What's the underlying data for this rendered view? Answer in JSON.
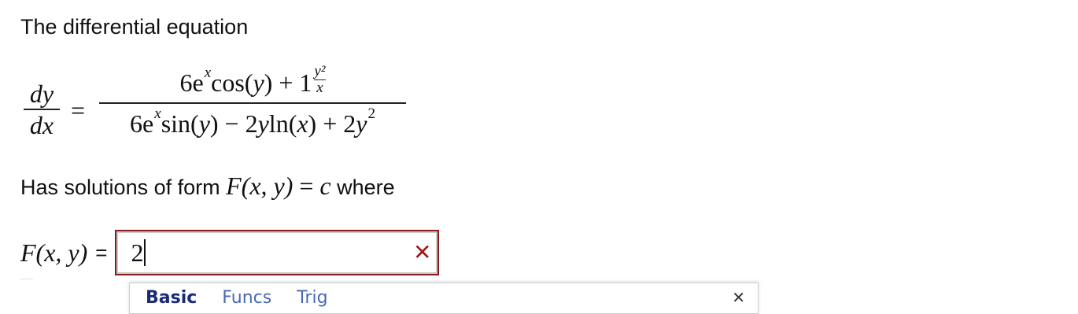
{
  "intro": {
    "text": "The differential equation"
  },
  "equation": {
    "lhs_num": "dy",
    "lhs_den": "dx",
    "equals": "=",
    "rhs_num_a": "6e",
    "rhs_num_a_sup": "x",
    "rhs_num_b": " cos(",
    "rhs_num_b_var": "y",
    "rhs_num_c": ") + 1",
    "rhs_num_frac_num": "y²",
    "rhs_num_frac_den": "x",
    "rhs_den_a": "6e",
    "rhs_den_a_sup": "x",
    "rhs_den_b": " sin(",
    "rhs_den_b_var": "y",
    "rhs_den_c": ") − 2",
    "rhs_den_c_var": "y",
    "rhs_den_d": " ln(",
    "rhs_den_d_var": "x",
    "rhs_den_e": ") + 2",
    "rhs_den_e_var": "y",
    "rhs_den_e_sup": "2"
  },
  "solution_line": {
    "prefix": "Has solutions of form ",
    "math_F": "F",
    "math_args": "(x, y)",
    "math_eq": " = ",
    "math_c": "c",
    "suffix": " where"
  },
  "answer": {
    "label_F": "F",
    "label_args": "(x, y)",
    "equals": "=",
    "input_value": "2",
    "clear_symbol": "✕"
  },
  "palette": {
    "tabs": [
      "Basic",
      "Funcs",
      "Trig"
    ],
    "active_tab": "Basic",
    "close_symbol": "✕"
  },
  "colors": {
    "input_border": "#8b1a1a",
    "clear_icon": "#9b1c1c",
    "tab_active": "#1a2a7a",
    "tab_inactive": "#4a68b8"
  }
}
